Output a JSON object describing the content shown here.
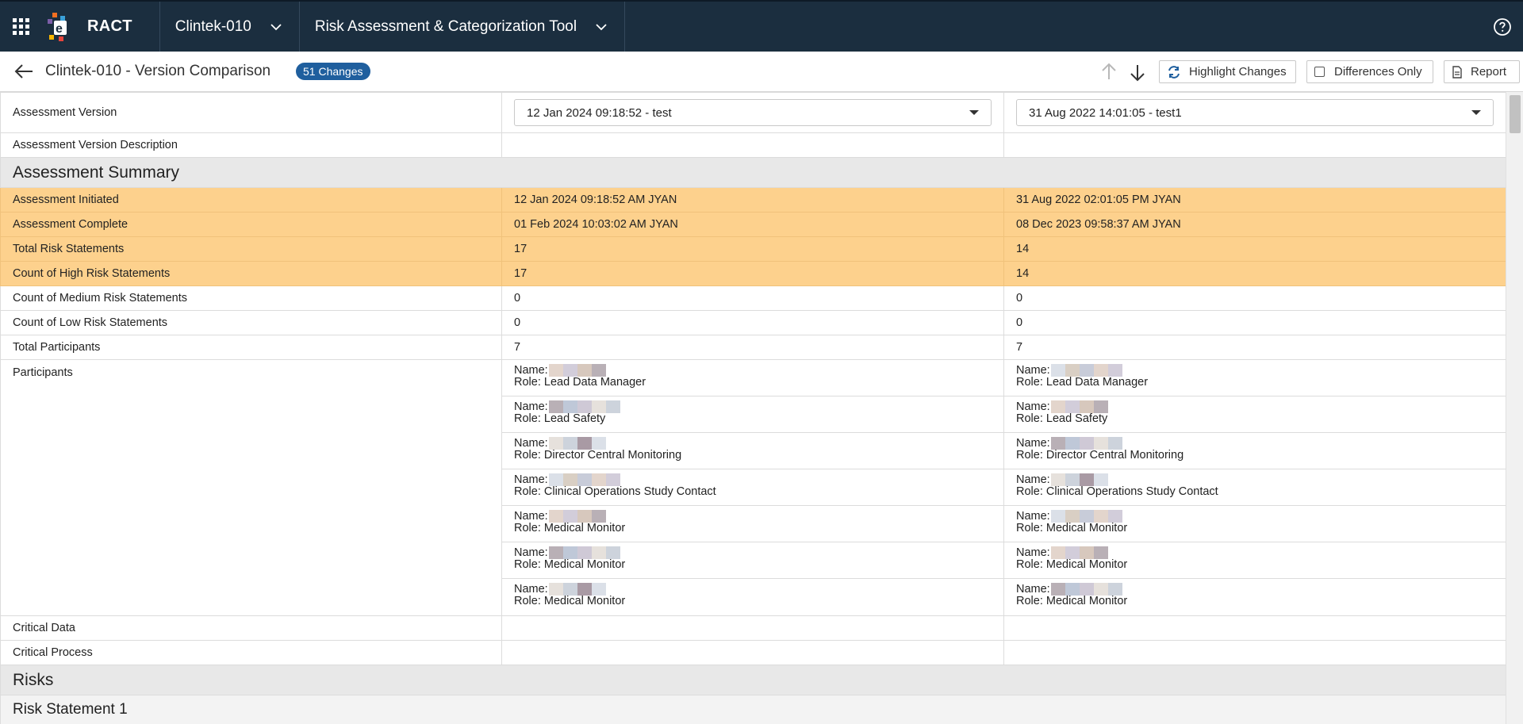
{
  "app": {
    "name": "RACT"
  },
  "nav": {
    "study": "Clintek-010",
    "tool": "Risk Assessment & Categorization Tool"
  },
  "subheader": {
    "title": "Clintek-010 - Version Comparison",
    "changes_badge": "51 Changes",
    "highlight_label": "Highlight Changes",
    "differences_label": "Differences Only",
    "report_label": "Report"
  },
  "versions": {
    "label": "Assessment Version",
    "left": "12 Jan 2024 09:18:52 - test",
    "right": "31 Aug 2022 14:01:05 - test1",
    "description_label": "Assessment Version Description"
  },
  "summary": {
    "title": "Assessment Summary",
    "rows": [
      {
        "label": "Assessment Initiated",
        "left": "12 Jan 2024 09:18:52 AM JYAN",
        "right": "31 Aug 2022 02:01:05 PM JYAN",
        "changed": true
      },
      {
        "label": "Assessment Complete",
        "left": "01 Feb 2024 10:03:02 AM JYAN",
        "right": "08 Dec 2023 09:58:37 AM JYAN",
        "changed": true
      },
      {
        "label": "Total Risk Statements",
        "left": "17",
        "right": "14",
        "changed": true
      },
      {
        "label": "Count of High Risk Statements",
        "left": "17",
        "right": "14",
        "changed": true
      },
      {
        "label": "Count of Medium Risk Statements",
        "left": "0",
        "right": "0",
        "changed": false
      },
      {
        "label": "Count of Low Risk Statements",
        "left": "0",
        "right": "0",
        "changed": false
      },
      {
        "label": "Total Participants",
        "left": "7",
        "right": "7",
        "changed": false
      }
    ]
  },
  "participants": {
    "label": "Participants",
    "name_prefix": "Name:",
    "role_prefix": "Role:",
    "left": [
      {
        "role": "Lead Data Manager"
      },
      {
        "role": "Lead Safety"
      },
      {
        "role": "Director Central Monitoring"
      },
      {
        "role": "Clinical Operations Study Contact"
      },
      {
        "role": "Medical Monitor"
      },
      {
        "role": "Medical Monitor"
      },
      {
        "role": "Medical Monitor"
      }
    ],
    "right": [
      {
        "role": "Lead Data Manager"
      },
      {
        "role": "Lead Safety"
      },
      {
        "role": "Director Central Monitoring"
      },
      {
        "role": "Clinical Operations Study Contact"
      },
      {
        "role": "Medical Monitor"
      },
      {
        "role": "Medical Monitor"
      },
      {
        "role": "Medical Monitor"
      }
    ]
  },
  "critical": {
    "data_label": "Critical Data",
    "process_label": "Critical Process"
  },
  "risks": {
    "title": "Risks",
    "statement_1": "Risk Statement 1"
  },
  "colors": {
    "topbar": "#1b2e3f",
    "highlight": "#fdd18d",
    "badge": "#1f5f9e",
    "section": "#e8e8e8"
  }
}
